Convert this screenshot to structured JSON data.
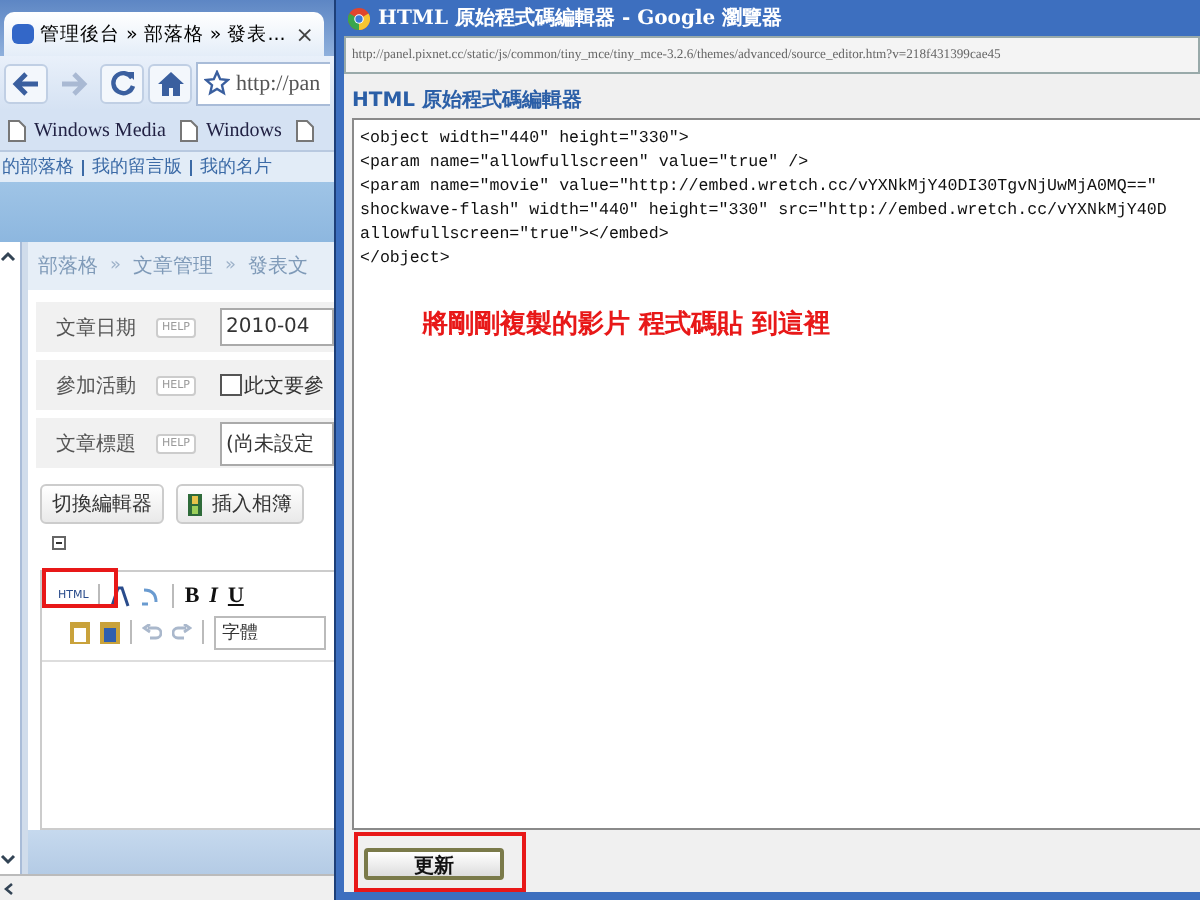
{
  "browser_tab": {
    "title": "管理後台 » 部落格 » 發表...",
    "close": "×"
  },
  "address": "http://pan",
  "bookmarks": [
    {
      "label": "Windows Media"
    },
    {
      "label": "Windows"
    }
  ],
  "site_links": [
    "的部落格",
    "我的留言版",
    "我的名片"
  ],
  "breadcrumb": {
    "items": [
      "部落格",
      "文章管理",
      "發表文"
    ],
    "separator": "»"
  },
  "form_rows": [
    {
      "kind": "text",
      "label": "文章日期",
      "help": "HELP",
      "value": "2010-04"
    },
    {
      "kind": "checkbox",
      "label": "參加活動",
      "help": "HELP",
      "checked": false,
      "value": "此文要參"
    },
    {
      "kind": "text",
      "label": "文章標題",
      "help": "HELP",
      "value": "(尚未設定"
    }
  ],
  "editor_buttons": [
    {
      "label": "切換編輯器",
      "kind": "plain"
    },
    {
      "label": "插入相簿",
      "kind": "film"
    }
  ],
  "editor_toolbar": {
    "html_button": "HTML",
    "bold": "B",
    "italic": "I",
    "underline": "U",
    "font_select": "字體"
  },
  "popup": {
    "title": "HTML 原始程式碼編輯器 - Google 瀏覽器",
    "url": "http://panel.pixnet.cc/static/js/common/tiny_mce/tiny_mce-3.2.6/themes/advanced/source_editor.htm?v=218f431399cae45",
    "heading": "HTML 原始程式碼編輯器",
    "code_lines": [
      "<object width=\"440\" height=\"330\">",
      "<param name=\"allowfullscreen\" value=\"true\" />",
      "<param name=\"movie\" value=\"http://embed.wretch.cc/vYXNkMjY40DI30TgvNjUwMjA0MQ==\"",
      "shockwave-flash\" width=\"440\" height=\"330\" src=\"http://embed.wretch.cc/vYXNkMjY40D",
      "allowfullscreen=\"true\"></embed>",
      "</object>"
    ],
    "annotation": "將剛剛複製的影片 程式碼貼 到這裡",
    "update_button": "更新"
  }
}
